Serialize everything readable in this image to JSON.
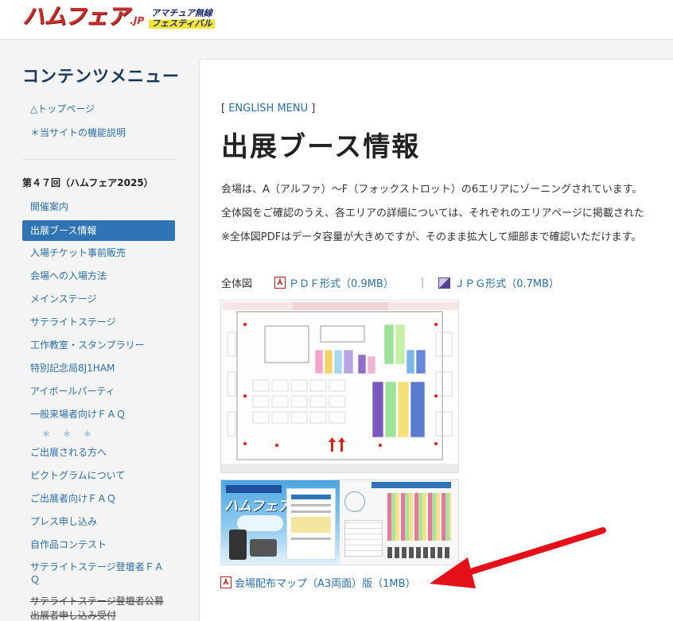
{
  "header": {
    "logo_main": "ハムフェア",
    "logo_jp": ".JP",
    "logo_sub_line1": "アマチュア無線",
    "logo_sub_line2": "フェスティバル"
  },
  "sidebar": {
    "title": "コンテンツメニュー",
    "top_links": [
      "△トップページ",
      "＊当サイトの機能説明"
    ],
    "section": "第４７回（ハムフェア2025）",
    "items": [
      "開催案内",
      "出展ブース情報",
      "入場チケット事前販売",
      "会場への入場方法",
      "メインステージ",
      "サテライトステージ",
      "工作教室・スタンプラリー",
      "特別記念局8J1HAM",
      "アイボールパーティ",
      "一般来場者向けＦＡＱ"
    ],
    "stars": "＊＊＊",
    "items2": [
      "ご出展される方へ",
      "ピクトグラムについて",
      "ご出展者向けＦＡＱ",
      "プレス申し込み",
      "自作品コンテスト",
      "サテライトステージ登壇者ＦＡＱ",
      "サテライトステージ登壇者公募",
      "出展者申し込み受付"
    ],
    "active_index": 1
  },
  "main": {
    "english_menu": "ENGLISH MENU",
    "title": "出展ブース情報",
    "paragraphs": [
      "会場は、A（アルファ）〜F（フォックストロット）の6エリアにゾーニングされています。",
      "全体図をご確認のうえ、各エリアの詳細については、それぞれのエリアページに掲載された",
      "※全体図PDFはデータ容量が大きめですが、そのまま拡大して細部まで確認いただけます。"
    ],
    "download_label": "全体図",
    "pdf_link": "ＰＤＦ形式（0.9MB）",
    "separator": "|",
    "jpg_link": "ＪＰＧ形式（0.7MB）",
    "map_link": "会場配布マップ（A3両面）版（1MB）",
    "poster_title": "ハムフェア"
  },
  "colors": {
    "accent": "#2f74b5",
    "link": "#2a6ea6",
    "arrow": "#e3101a"
  }
}
